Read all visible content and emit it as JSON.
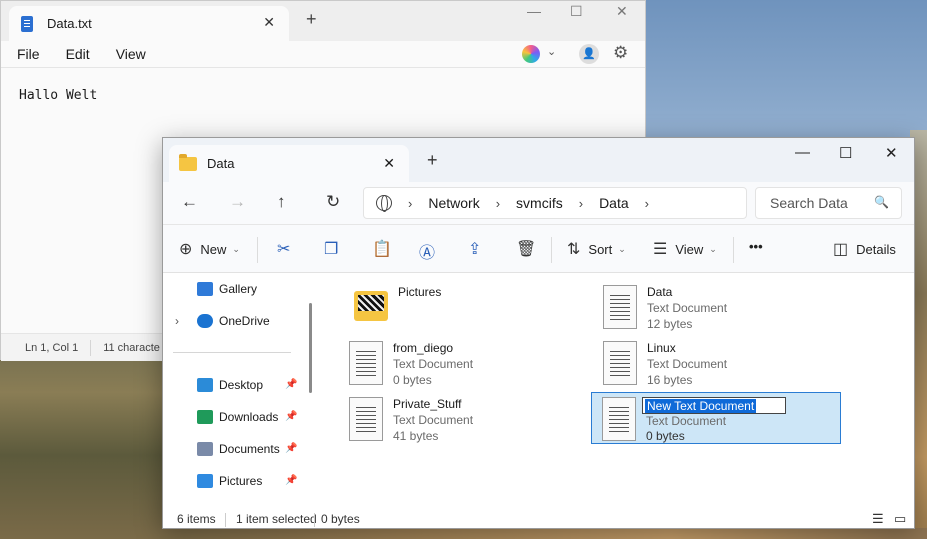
{
  "notepad": {
    "tab_title": "Data.txt",
    "menu": [
      "File",
      "Edit",
      "View"
    ],
    "content": "Hallo Welt",
    "status": {
      "position": "Ln 1, Col 1",
      "characters": "11 characte"
    }
  },
  "explorer": {
    "tab_title": "Data",
    "breadcrumb": [
      "Network",
      "svmcifs",
      "Data"
    ],
    "search_placeholder": "Search Data",
    "commands": {
      "new": "New",
      "sort": "Sort",
      "view": "View",
      "more": "•••",
      "details": "Details"
    },
    "sidebar": [
      {
        "label": "Gallery",
        "pinned": false
      },
      {
        "label": "OneDrive",
        "pinned": false
      },
      {
        "label": "Desktop",
        "pinned": true
      },
      {
        "label": "Downloads",
        "pinned": true
      },
      {
        "label": "Documents",
        "pinned": true
      },
      {
        "label": "Pictures",
        "pinned": true
      }
    ],
    "files": [
      {
        "name": "Pictures",
        "type": "",
        "size": "",
        "icon": "folder-icon"
      },
      {
        "name": "Data",
        "type": "Text Document",
        "size": "12 bytes",
        "icon": "text-file-icon"
      },
      {
        "name": "from_diego",
        "type": "Text Document",
        "size": "0 bytes",
        "icon": "text-file-icon"
      },
      {
        "name": "Linux",
        "type": "Text Document",
        "size": "16 bytes",
        "icon": "text-file-icon"
      },
      {
        "name": "Private_Stuff",
        "type": "Text Document",
        "size": "41 bytes",
        "icon": "text-file-icon"
      },
      {
        "name": "New Text Document",
        "type": "Text Document",
        "size": "0 bytes",
        "icon": "text-file-icon",
        "renaming": true
      }
    ],
    "status": {
      "count": "6 items",
      "selection": "1 item selected",
      "selection_size": "0 bytes"
    }
  },
  "colors": {
    "selection": "#cde6f7",
    "selection_border": "#2a7cd3",
    "accent": "#0f6ad8",
    "folder": "#f5c542"
  }
}
